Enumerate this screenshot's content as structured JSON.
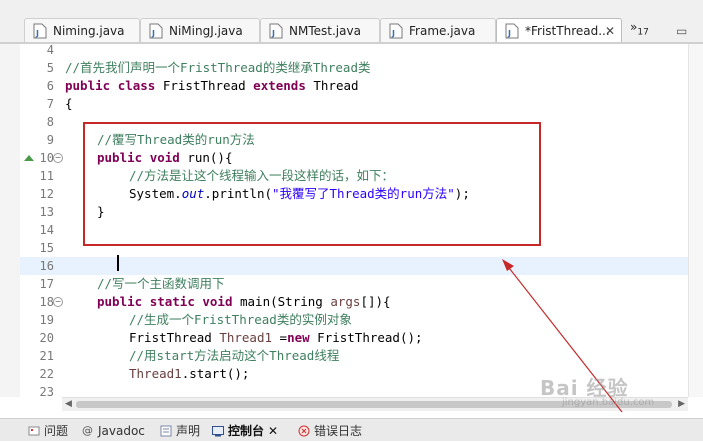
{
  "tabs": [
    {
      "label": "Niming.java",
      "active": false
    },
    {
      "label": "NiMingJ.java",
      "active": false
    },
    {
      "label": "NMTest.java",
      "active": false
    },
    {
      "label": "Frame.java",
      "active": false
    },
    {
      "label": "*FristThread...",
      "active": true
    }
  ],
  "tab_close": "✕",
  "tab_overflow": {
    "chevron": "»",
    "count": "17"
  },
  "editor": {
    "line_numbers": [
      "4",
      "5",
      "6",
      "7",
      "8",
      "9",
      "10",
      "11",
      "12",
      "13",
      "14",
      "15",
      "16",
      "17",
      "18",
      "19",
      "20",
      "21",
      "22",
      "23"
    ],
    "current_line": "16",
    "code": {
      "l5_comment": "//首先我们声明一个FristThread的类继承Thread类",
      "l6_kw1": "public",
      "l6_kw2": "class",
      "l6_name": " FristThread ",
      "l6_kw3": "extends",
      "l6_super": " Thread",
      "l7": "{",
      "l9_comment": "//覆写Thread类的run方法",
      "l10_kw1": "public",
      "l10_kw2": "void",
      "l10_rest": " run(){",
      "l11_comment": "//方法是让这个线程输入一段这样的话，如下：",
      "l12_pre": "System.",
      "l12_field": "out",
      "l12_mid": ".println(",
      "l12_str": "\"我覆写了Thread类的run方法\"",
      "l12_end": ");",
      "l13": "}",
      "l17_comment": "//写一个主函数调用下",
      "l18_kw1": "public",
      "l18_kw2": "static",
      "l18_kw3": "void",
      "l18_mid": " main(String ",
      "l18_var": "args",
      "l18_end": "[]){",
      "l19_comment": "//生成一个FristThread类的实例对象",
      "l20_pre": "FristThread ",
      "l20_var": "Thread1",
      "l20_eq": " =",
      "l20_kw": "new",
      "l20_end": " FristThread();",
      "l21_comment": "//用start方法启动这个Thread线程",
      "l22_var": "Thread1",
      "l22_end": ".start();"
    }
  },
  "bottom_tabs": [
    {
      "label": "问题",
      "icon": "problems-icon",
      "active": false
    },
    {
      "label": "Javadoc",
      "icon": "at-icon",
      "active": false
    },
    {
      "label": "声明",
      "icon": "declaration-icon",
      "active": false
    },
    {
      "label": "控制台",
      "icon": "console-icon",
      "active": true
    },
    {
      "label": "错误日志",
      "icon": "error-log-icon",
      "active": false
    }
  ],
  "console_close": "✕",
  "watermark": {
    "main": "Bai 经验",
    "sub": "jingyan.baidu.com"
  },
  "colors": {
    "keyword": "#7f0055",
    "comment": "#3f7f5f",
    "string": "#2a00ff",
    "annotation_box": "#c62828",
    "current_line": "#e8f2fe"
  }
}
